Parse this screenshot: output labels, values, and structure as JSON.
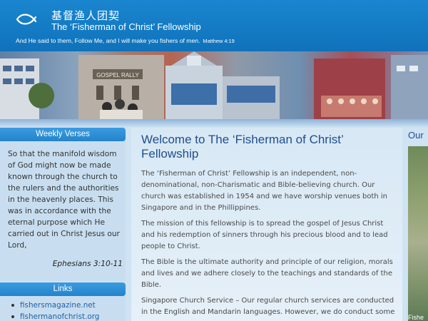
{
  "header": {
    "logo_icon": "fish-icon",
    "title_cn": "基督渔人团契",
    "title_en": "The ‘Fisherman of Christ’ Fellowship",
    "tagline": "And He said to them, Follow Me, and I will make you fishers of men.",
    "tagline_ref": "Matthew 4:19"
  },
  "banner": {
    "sign_text": "GOSPEL RALLY"
  },
  "sidebar": {
    "verses_heading": "Weekly Verses",
    "verse_text": "So that the manifold wisdom of God might now be made known through the church to the rulers and the authorities in the heavenly places. This was in accordance with the eternal purpose which He carried out in Christ Jesus our Lord,",
    "verse_ref": "Ephesians 3:10-11",
    "links_heading": "Links",
    "links": [
      "fishersmagazine.net",
      "fishermanofchrist.org"
    ]
  },
  "main": {
    "title": "Welcome to The ‘Fisherman of Christ’ Fellowship",
    "paragraphs": [
      "The ‘Fisherman of Christ’ Fellowship is an independent, non-denominational, non-Charismatic and Bible-believing church. Our church was established in 1954 and we have worship venues both in Singapore and in the Phillippines.",
      "The mission of this fellowship is to spread the gospel of Jesus Christ and his redemption of sinners through his precious blood and to lead people to Christ.",
      "The Bible is the ultimate authority and principle of our religion, morals and lives and we adhere closely to the teachings and standards of the Bible.",
      "Singapore Church Service – Our regular church services are conducted in the English and Mandarin languages. However, we do conduct some"
    ]
  },
  "right": {
    "title": "Our",
    "caption": "Fishe"
  },
  "colors": {
    "header_blue": "#1080c8",
    "panel_head": "#2a8ad3",
    "title_blue": "#1e4f8e",
    "link_blue": "#2060a8"
  }
}
